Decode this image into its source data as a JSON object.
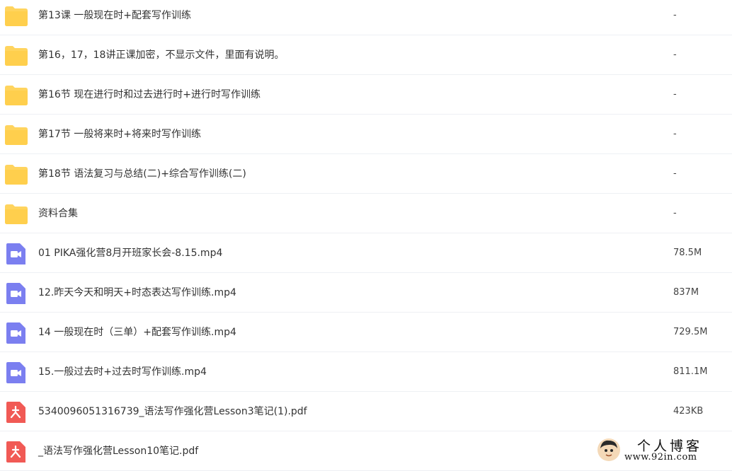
{
  "files": [
    {
      "name": "第13课 一般现在时+配套写作训练",
      "size": "-",
      "type": "folder",
      "icon": "folder-icon"
    },
    {
      "name": "第16，17，18讲正课加密，不显示文件，里面有说明。",
      "size": "-",
      "type": "folder",
      "icon": "folder-icon"
    },
    {
      "name": "第16节 现在进行时和过去进行时+进行时写作训练",
      "size": "-",
      "type": "folder",
      "icon": "folder-icon"
    },
    {
      "name": "第17节 一般将来时+将来时写作训练",
      "size": "-",
      "type": "folder",
      "icon": "folder-icon"
    },
    {
      "name": "第18节 语法复习与总结(二)+综合写作训练(二)",
      "size": "-",
      "type": "folder",
      "icon": "folder-icon"
    },
    {
      "name": "资料合集",
      "size": "-",
      "type": "folder",
      "icon": "folder-icon"
    },
    {
      "name": "01 PIKA强化营8月开班家长会-8.15.mp4",
      "size": "78.5M",
      "type": "video",
      "icon": "video-file-icon"
    },
    {
      "name": "12.昨天今天和明天+时态表达写作训练.mp4",
      "size": "837M",
      "type": "video",
      "icon": "video-file-icon"
    },
    {
      "name": "14 一般现在时（三单）+配套写作训练.mp4",
      "size": "729.5M",
      "type": "video",
      "icon": "video-file-icon"
    },
    {
      "name": "15.一般过去时+过去时写作训练.mp4",
      "size": "811.1M",
      "type": "video",
      "icon": "video-file-icon"
    },
    {
      "name": "5340096051316739_语法写作强化营Lesson3笔记(1).pdf",
      "size": "423KB",
      "type": "pdf",
      "icon": "pdf-file-icon"
    },
    {
      "name": "_语法写作强化营Lesson10笔记.pdf",
      "size": "",
      "type": "pdf",
      "icon": "pdf-file-icon"
    }
  ],
  "watermark": {
    "title": "个人博客",
    "url": "www.92in.com"
  },
  "colors": {
    "folder": "#ffd45e",
    "video": "#7b7ff0",
    "pdf": "#f15a55",
    "divider": "#eef0f4"
  }
}
